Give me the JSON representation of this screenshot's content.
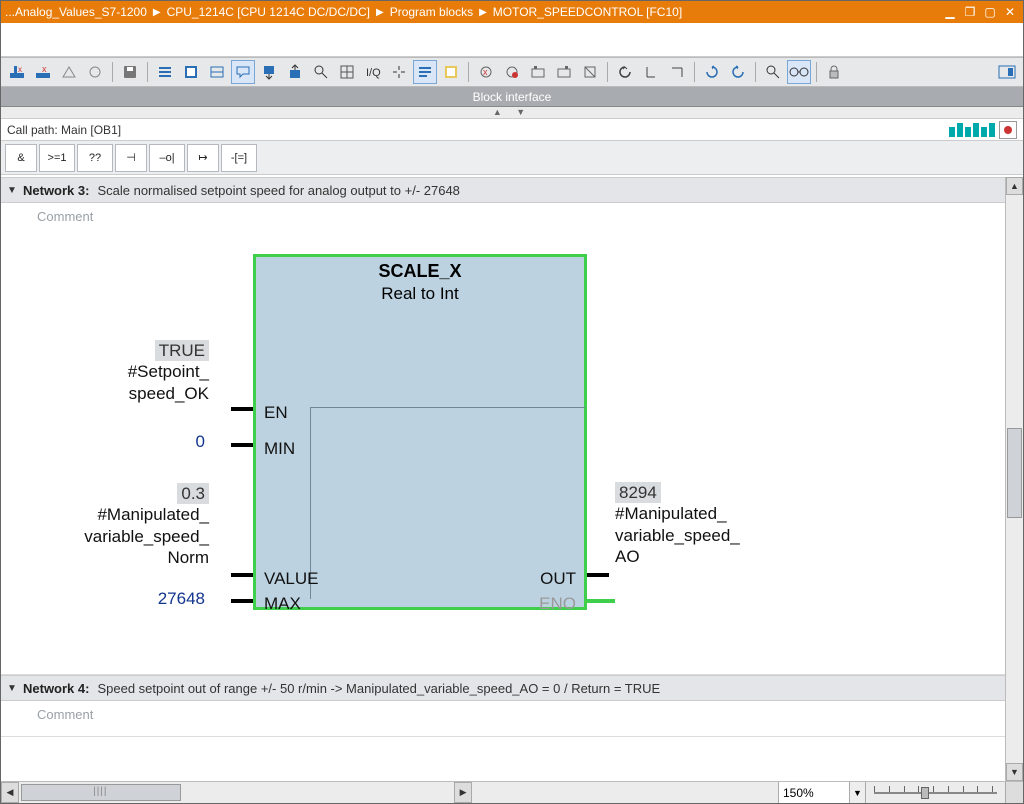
{
  "titlebar": {
    "crumbs": [
      "...Analog_Values_S7-1200",
      "CPU_1214C [CPU 1214C DC/DC/DC]",
      "Program blocks",
      "MOTOR_SPEEDCONTROL [FC10]"
    ]
  },
  "block_interface_label": "Block interface",
  "callpath": {
    "label": "Call path:",
    "value": "Main [OB1]"
  },
  "palette": {
    "items": [
      "&",
      ">=1",
      "??",
      "⊣",
      "–o|",
      "↦",
      "-[=]"
    ]
  },
  "network3": {
    "heading": "Network 3:",
    "desc": "Scale normalised setpoint speed for analog output to +/- 27648",
    "comment_placeholder": "Comment",
    "block": {
      "title": "SCALE_X",
      "subtitle": "Real  to  Int",
      "ports_left": {
        "en": "EN",
        "min": "MIN",
        "value": "VALUE",
        "max": "MAX"
      },
      "ports_right": {
        "out": "OUT",
        "eno": "ENO"
      }
    },
    "io": {
      "en": {
        "mon": "TRUE",
        "tag": "#Setpoint_\nspeed_OK"
      },
      "min": {
        "mon": "0"
      },
      "value": {
        "mon": "0.3",
        "tag": "#Manipulated_\nvariable_speed_\nNorm"
      },
      "max": {
        "mon": "27648"
      },
      "out": {
        "mon": "8294",
        "tag": "#Manipulated_\nvariable_speed_\nAO"
      }
    }
  },
  "network4": {
    "heading": "Network 4:",
    "desc": "Speed setpoint out of range +/- 50 r/min -> Manipulated_variable_speed_AO = 0 / Return = TRUE",
    "comment_placeholder": "Comment"
  },
  "zoom": {
    "value": "150%"
  }
}
